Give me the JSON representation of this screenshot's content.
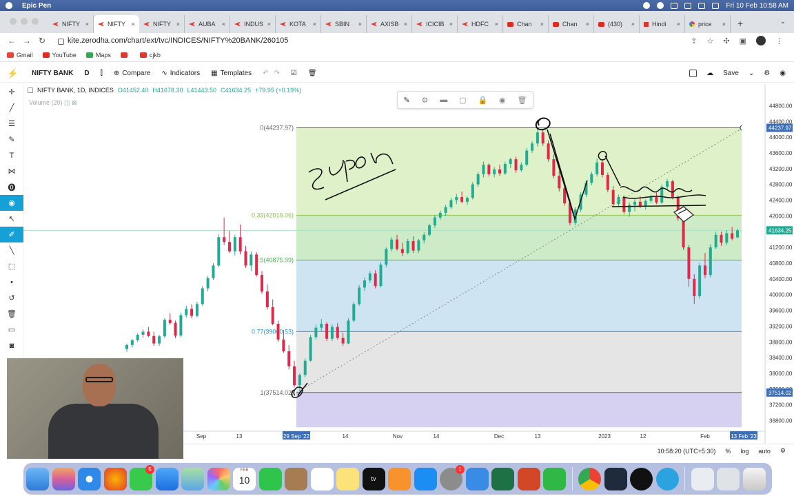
{
  "os": {
    "app_name": "Epic Pen",
    "clock": "Fri 10 Feb  10:58 AM"
  },
  "browser": {
    "tabs": [
      {
        "label": "NIFTY",
        "icon": "kite-icon"
      },
      {
        "label": "NIFTY",
        "icon": "kite-icon"
      },
      {
        "label": "NIFTY",
        "icon": "kite-icon"
      },
      {
        "label": "AUBA",
        "icon": "kite-icon"
      },
      {
        "label": "INDUS",
        "icon": "kite-icon"
      },
      {
        "label": "KOTA",
        "icon": "kite-icon"
      },
      {
        "label": "SBIN",
        "icon": "kite-icon"
      },
      {
        "label": "AXISB",
        "icon": "kite-icon"
      },
      {
        "label": "ICICIB",
        "icon": "kite-icon"
      },
      {
        "label": "HDFC",
        "icon": "kite-icon"
      },
      {
        "label": "Chan",
        "icon": "youtube-icon"
      },
      {
        "label": "Chan",
        "icon": "youtube-icon"
      },
      {
        "label": "(430)",
        "icon": "youtube-icon"
      },
      {
        "label": "Hindi",
        "icon": "indiatoday-icon"
      },
      {
        "label": "price",
        "icon": "google-icon"
      }
    ],
    "active_tab_index": 1,
    "url": "kite.zerodha.com/chart/ext/tvc/INDICES/NIFTY%20BANK/260105",
    "bookmarks": [
      {
        "label": "Gmail",
        "color": "#ea4335"
      },
      {
        "label": "YouTube",
        "color": "#e02b20"
      },
      {
        "label": "Maps",
        "color": "#34a853"
      },
      {
        "label": "",
        "color": "#e2382c"
      },
      {
        "label": "cjkb",
        "color": "#e2382c"
      }
    ]
  },
  "toolbar": {
    "symbol": "NIFTY BANK",
    "interval": "D",
    "compare_label": "Compare",
    "indicators_label": "Indicators",
    "templates_label": "Templates",
    "save_label": "Save"
  },
  "legend": {
    "title": "NIFTY BANK, 1D, INDICES",
    "open": "O41452.40",
    "high": "H41678.30",
    "low": "L41443.50",
    "close": "C41634.25",
    "change": "+79.95 (+0.19%)",
    "volume_label": "Volume (20)"
  },
  "status": {
    "time": "10:58:20 (UTC+5:30)",
    "percent": "%",
    "log": "log",
    "auto": "auto"
  },
  "chart_data": {
    "type": "candlestick",
    "title": "NIFTY BANK, 1D, INDICES",
    "x_tick_labels": [
      "Sep",
      "13",
      "29 Sep '22",
      "14",
      "Nov",
      "14",
      "Dec",
      "13",
      "2023",
      "12",
      "Feb",
      "13 Feb '23"
    ],
    "y_tick_labels": [
      "44800.00",
      "44400.00",
      "44000.00",
      "43600.00",
      "43200.00",
      "42800.00",
      "42400.00",
      "42000.00",
      "41600.00",
      "41200.00",
      "40800.00",
      "40400.00",
      "40000.00",
      "39600.00",
      "39200.00",
      "38800.00",
      "38400.00",
      "38000.00",
      "37600.00",
      "37200.00",
      "36800.00"
    ],
    "ylim": [
      36600,
      45000
    ],
    "price_labels": {
      "high_marker": "44237.97",
      "last_price": "41634.25",
      "low_marker": "37514.02"
    },
    "fib_levels": [
      {
        "label": "0(44237.97)",
        "value": 44237.97,
        "color": "#666666"
      },
      {
        "label": "0.33(42019.06)",
        "value": 42019.06,
        "color": "#8bc34a"
      },
      {
        "label": "0.5(40875.99)",
        "value": 40875.99,
        "color": "#4caf50"
      },
      {
        "label": "0.77(39060.53)",
        "value": 39060.53,
        "color": "#2196f3"
      },
      {
        "label": "1(37514.02)",
        "value": 37514.02,
        "color": "#666666"
      }
    ],
    "colors": {
      "up": "#22ab94",
      "down": "#e0294a"
    },
    "candles": [
      [
        38620,
        38760,
        38550,
        38720
      ],
      [
        38720,
        38880,
        38650,
        38840
      ],
      [
        38840,
        39020,
        38800,
        38980
      ],
      [
        38980,
        39120,
        38900,
        39060
      ],
      [
        39060,
        39180,
        38920,
        38950
      ],
      [
        38950,
        39060,
        38700,
        38760
      ],
      [
        38760,
        38980,
        38700,
        38940
      ],
      [
        38940,
        39400,
        38900,
        39360
      ],
      [
        39360,
        39520,
        39240,
        39280
      ],
      [
        39280,
        39340,
        38900,
        38960
      ],
      [
        38960,
        39540,
        38920,
        39480
      ],
      [
        39480,
        39720,
        39420,
        39640
      ],
      [
        39640,
        39760,
        39400,
        39460
      ],
      [
        39460,
        39820,
        39420,
        39760
      ],
      [
        39760,
        40220,
        39720,
        40160
      ],
      [
        40160,
        40480,
        40080,
        40420
      ],
      [
        40420,
        40800,
        40380,
        40740
      ],
      [
        40740,
        41540,
        40700,
        41460
      ],
      [
        41460,
        41960,
        41260,
        41340
      ],
      [
        41340,
        41620,
        41060,
        41100
      ],
      [
        41100,
        41520,
        41000,
        41460
      ],
      [
        41460,
        41780,
        41020,
        41100
      ],
      [
        41100,
        41240,
        40680,
        40740
      ],
      [
        40740,
        41100,
        40600,
        41020
      ],
      [
        41020,
        41080,
        40460,
        40500
      ],
      [
        40500,
        40600,
        40020,
        40080
      ],
      [
        40080,
        40260,
        39620,
        39680
      ],
      [
        39680,
        39880,
        39220,
        39260
      ],
      [
        39260,
        39340,
        38800,
        38860
      ],
      [
        38860,
        39100,
        38520,
        38560
      ],
      [
        38560,
        38720,
        38100,
        38180
      ],
      [
        38180,
        38320,
        37640,
        37700
      ],
      [
        37700,
        38000,
        37514,
        37960
      ],
      [
        37960,
        38380,
        37900,
        38320
      ],
      [
        38320,
        38980,
        38300,
        38920
      ],
      [
        38920,
        39240,
        38860,
        39160
      ],
      [
        39160,
        39380,
        39080,
        39260
      ],
      [
        39260,
        39300,
        38820,
        38880
      ],
      [
        38880,
        39240,
        38820,
        39180
      ],
      [
        39180,
        39280,
        38860,
        38900
      ],
      [
        38900,
        39040,
        38700,
        38760
      ],
      [
        38760,
        39400,
        38740,
        39340
      ],
      [
        39340,
        39820,
        39300,
        39760
      ],
      [
        39760,
        40240,
        39720,
        40180
      ],
      [
        40180,
        40440,
        40100,
        40360
      ],
      [
        40360,
        40600,
        40300,
        40540
      ],
      [
        40540,
        40620,
        40160,
        40220
      ],
      [
        40220,
        40820,
        40180,
        40760
      ],
      [
        40760,
        41200,
        40700,
        41160
      ],
      [
        41160,
        41460,
        41100,
        41400
      ],
      [
        41400,
        41520,
        41120,
        41160
      ],
      [
        41160,
        41320,
        40980,
        41060
      ],
      [
        41060,
        41420,
        41020,
        41360
      ],
      [
        41360,
        41480,
        41060,
        41120
      ],
      [
        41120,
        41420,
        41060,
        41380
      ],
      [
        41380,
        41580,
        41300,
        41520
      ],
      [
        41520,
        41800,
        41480,
        41760
      ],
      [
        41760,
        42020,
        41700,
        41960
      ],
      [
        41960,
        42140,
        41900,
        42080
      ],
      [
        42080,
        42280,
        42000,
        42220
      ],
      [
        42220,
        42460,
        42180,
        42400
      ],
      [
        42400,
        42560,
        42300,
        42480
      ],
      [
        42480,
        42620,
        42320,
        42360
      ],
      [
        42360,
        42500,
        42280,
        42460
      ],
      [
        42460,
        42860,
        42420,
        42800
      ],
      [
        42800,
        43120,
        42740,
        43060
      ],
      [
        43060,
        43380,
        42980,
        43300
      ],
      [
        43300,
        43340,
        43000,
        43060
      ],
      [
        43060,
        43240,
        42980,
        43180
      ],
      [
        43180,
        43300,
        43020,
        43080
      ],
      [
        43080,
        43380,
        43040,
        43320
      ],
      [
        43320,
        43480,
        43220,
        43440
      ],
      [
        43440,
        43500,
        43100,
        43160
      ],
      [
        43160,
        43360,
        43120,
        43300
      ],
      [
        43300,
        43720,
        43260,
        43660
      ],
      [
        43660,
        43900,
        43600,
        43840
      ],
      [
        43840,
        44237,
        43760,
        44120
      ],
      [
        44120,
        44200,
        43780,
        43840
      ],
      [
        43840,
        43920,
        43380,
        43440
      ],
      [
        43440,
        43560,
        42960,
        43020
      ],
      [
        43020,
        43140,
        42620,
        42700
      ],
      [
        42700,
        42800,
        42260,
        42320
      ],
      [
        42320,
        42420,
        41760,
        41820
      ],
      [
        41820,
        42220,
        41760,
        42160
      ],
      [
        42160,
        42600,
        42100,
        42540
      ],
      [
        42540,
        42900,
        42480,
        42840
      ],
      [
        42840,
        43120,
        42780,
        43060
      ],
      [
        43060,
        43460,
        43000,
        43360
      ],
      [
        43360,
        43440,
        42980,
        43040
      ],
      [
        43040,
        43100,
        42600,
        42660
      ],
      [
        42660,
        42760,
        42240,
        42300
      ],
      [
        42300,
        42540,
        42220,
        42480
      ],
      [
        42480,
        42520,
        42040,
        42100
      ],
      [
        42100,
        42340,
        41980,
        42280
      ],
      [
        42280,
        42420,
        42120,
        42360
      ],
      [
        42360,
        42500,
        42200,
        42240
      ],
      [
        42240,
        42420,
        42160,
        42380
      ],
      [
        42380,
        42540,
        42320,
        42480
      ],
      [
        42480,
        42600,
        42300,
        42340
      ],
      [
        42340,
        42800,
        42300,
        42740
      ],
      [
        42740,
        42940,
        42660,
        42880
      ],
      [
        42880,
        42920,
        42420,
        42480
      ],
      [
        42480,
        42520,
        41880,
        41940
      ],
      [
        41940,
        42040,
        41140,
        41200
      ],
      [
        41200,
        41260,
        40200,
        40400
      ],
      [
        40400,
        40520,
        39760,
        39960
      ],
      [
        39960,
        40800,
        39900,
        40740
      ],
      [
        40740,
        41060,
        40420,
        40500
      ],
      [
        40500,
        41280,
        40440,
        41200
      ],
      [
        41200,
        41600,
        41160,
        41520
      ],
      [
        41520,
        41600,
        41240,
        41320
      ],
      [
        41320,
        41640,
        41260,
        41560
      ],
      [
        41560,
        41720,
        41380,
        41420
      ],
      [
        41452.4,
        41678.3,
        41443.5,
        41634.25
      ]
    ]
  }
}
